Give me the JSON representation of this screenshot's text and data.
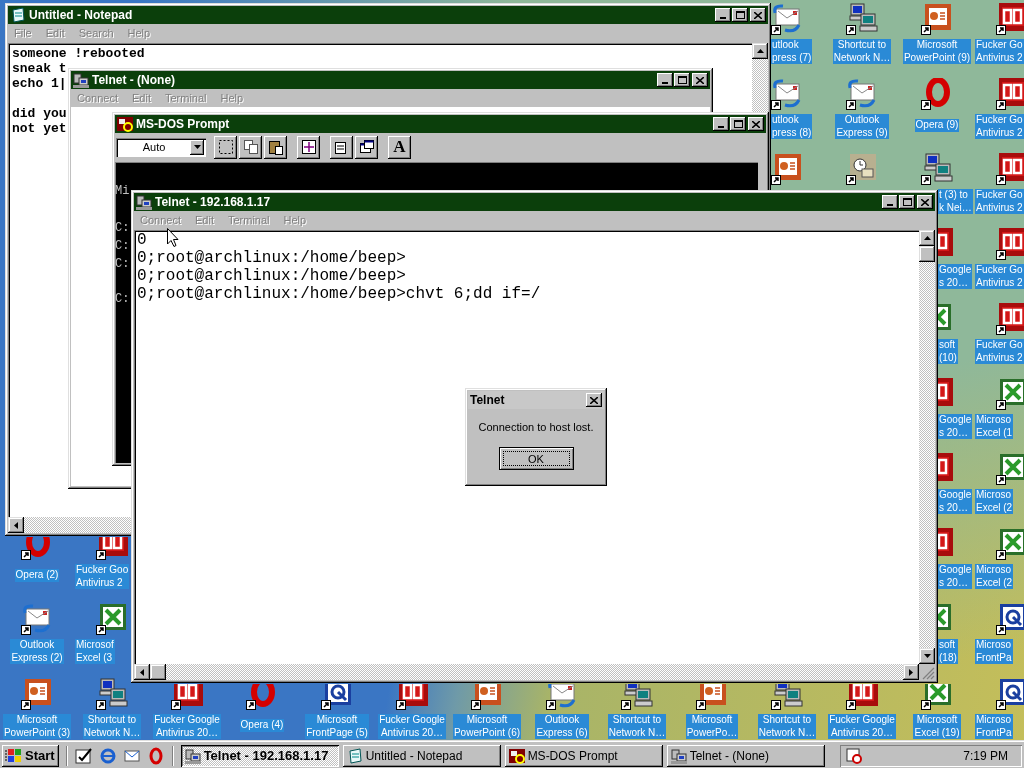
{
  "desktop": {
    "icons": [
      {
        "kind": "outlook",
        "lines": [
          "utlook",
          "press (7)"
        ]
      },
      {
        "kind": "network",
        "lines": [
          "Shortcut to",
          "Network N…"
        ]
      },
      {
        "kind": "powerpoint",
        "lines": [
          "Microsoft",
          "PowerPoint (9)"
        ]
      },
      {
        "kind": "antivirus",
        "lines": [
          "Fucker Go",
          "Antivirus 2"
        ]
      },
      {
        "kind": "outlook",
        "lines": [
          "utlook",
          "press (8)"
        ]
      },
      {
        "kind": "outlook",
        "lines": [
          "Outlook",
          "Express (9)"
        ]
      },
      {
        "kind": "opera",
        "lines": [
          "Opera (9)"
        ]
      },
      {
        "kind": "antivirus",
        "lines": [
          "Fucker Go",
          "Antivirus 2"
        ]
      },
      {
        "kind": "powerpoint"
      },
      {
        "kind": "scheduler"
      },
      {
        "kind": "network",
        "lines": [
          "t (3) to",
          "k Nei…"
        ]
      },
      {
        "kind": "antivirus",
        "lines": [
          "Fucker Go",
          "Antivirus 2"
        ]
      },
      {
        "kind": "antivirus",
        "lines": [
          "Google",
          "s 20…"
        ]
      },
      {
        "kind": "antivirus",
        "lines": [
          "Fucker Go",
          "Antivirus 2"
        ]
      },
      {
        "kind": "excel",
        "lines": [
          "soft",
          "(10)"
        ]
      },
      {
        "kind": "antivirus",
        "lines": [
          "Fucker Go",
          "Antivirus 2"
        ]
      },
      {
        "kind": "antivirus",
        "lines": [
          "Google",
          "s 20…"
        ]
      },
      {
        "kind": "excel",
        "lines": [
          "Microso",
          "Excel (1"
        ]
      },
      {
        "kind": "antivirus",
        "lines": [
          "Google",
          "s 20…"
        ]
      },
      {
        "kind": "excel",
        "lines": [
          "Microso",
          "Excel (2"
        ]
      },
      {
        "kind": "opera",
        "lines": [
          "Opera (2)"
        ]
      },
      {
        "kind": "antivirus",
        "lines": [
          "Fucker Goo",
          "Antivirus 2"
        ]
      },
      {
        "kind": "antivirus",
        "lines": [
          "Google",
          "s 20…"
        ]
      },
      {
        "kind": "excel",
        "lines": [
          "Microso",
          "Excel (2"
        ]
      },
      {
        "kind": "outlook",
        "lines": [
          "Outlook",
          "Express (2)"
        ]
      },
      {
        "kind": "excel",
        "lines": [
          "Microsof",
          "Excel (3"
        ]
      },
      {
        "kind": "excel",
        "lines": [
          "soft",
          "(18)"
        ]
      },
      {
        "kind": "frontpage",
        "lines": [
          "Microso",
          "FrontPa"
        ]
      },
      {
        "kind": "powerpoint",
        "lines": [
          "Microsoft",
          "PowerPoint (3)"
        ]
      },
      {
        "kind": "network",
        "lines": [
          "Shortcut to",
          "Network N…"
        ]
      },
      {
        "kind": "antivirus",
        "lines": [
          "Fucker Google",
          "Antivirus 20…"
        ]
      },
      {
        "kind": "opera",
        "lines": [
          "Opera (4)"
        ]
      },
      {
        "kind": "frontpage",
        "lines": [
          "Microsoft",
          "FrontPage (5)"
        ]
      },
      {
        "kind": "antivirus",
        "lines": [
          "Fucker Google",
          "Antivirus 20…"
        ]
      },
      {
        "kind": "powerpoint",
        "lines": [
          "Microsoft",
          "PowerPoint (6)"
        ]
      },
      {
        "kind": "outlook",
        "lines": [
          "Outlook",
          "Express (6)"
        ]
      },
      {
        "kind": "network",
        "lines": [
          "Shortcut to",
          "Network N…"
        ]
      },
      {
        "kind": "powerpoint",
        "lines": [
          "Microsoft",
          "PowerPo…"
        ]
      },
      {
        "kind": "network",
        "lines": [
          "Shortcut to",
          "Network N…"
        ]
      },
      {
        "kind": "antivirus",
        "lines": [
          "Fucker Google",
          "Antivirus 20…"
        ]
      },
      {
        "kind": "excel",
        "lines": [
          "Microsoft",
          "Excel (19)"
        ]
      },
      {
        "kind": "frontpage",
        "lines": [
          "Microso",
          "FrontPa"
        ]
      }
    ]
  },
  "windows": [
    {
      "kind": "notepad",
      "title": "Untitled - Notepad",
      "menu": [
        {
          "label": "File",
          "disabled": true
        },
        {
          "label": "Edit",
          "disabled": true
        },
        {
          "label": "Search",
          "disabled": true
        },
        {
          "label": "Help",
          "disabled": true
        }
      ],
      "paragraphs": [
        [
          "someone !rebooted",
          "sneak t",
          "echo 1|"
        ],
        [
          "did you",
          "not yet"
        ]
      ]
    },
    {
      "kind": "telnet",
      "title": "Telnet - (None)",
      "menu": [
        {
          "label": "Connect",
          "disabled": true
        },
        {
          "label": "Edit",
          "disabled": true
        },
        {
          "label": "Terminal",
          "disabled": true
        },
        {
          "label": "Help",
          "disabled": true
        }
      ]
    },
    {
      "kind": "dos",
      "title": "MS-DOS Prompt",
      "font_size": "Auto",
      "font_button": "A",
      "screen_lines": [
        "Mi",
        "C:",
        "C:",
        "C:",
        "C:"
      ]
    },
    {
      "kind": "telnet",
      "title": "Telnet - 192.168.1.17",
      "menu": [
        {
          "label": "Connect",
          "disabled": true
        },
        {
          "label": "Edit",
          "disabled": true
        },
        {
          "label": "Terminal",
          "disabled": true
        },
        {
          "label": "Help",
          "disabled": true
        }
      ],
      "lines": [
        "0",
        "0;root@archlinux:/home/beep>",
        "0;root@archlinux:/home/beep>",
        "0;root@archlinux:/home/beep>chvt 6;dd if=/"
      ]
    }
  ],
  "dialog": {
    "title": "Telnet",
    "message": "Connection to host lost.",
    "button": "OK"
  },
  "taskbar": {
    "start": "Start",
    "tasks": [
      {
        "kind": "telnet",
        "label": "Telnet - 192.168.1.17",
        "selected": true
      },
      {
        "kind": "notepad",
        "label": "Untitled - Notepad",
        "selected": false
      },
      {
        "kind": "dos",
        "label": "MS-DOS Prompt",
        "selected": false
      },
      {
        "kind": "telnet",
        "label": "Telnet - (None)",
        "selected": false
      }
    ],
    "clock": "7:19 PM"
  }
}
